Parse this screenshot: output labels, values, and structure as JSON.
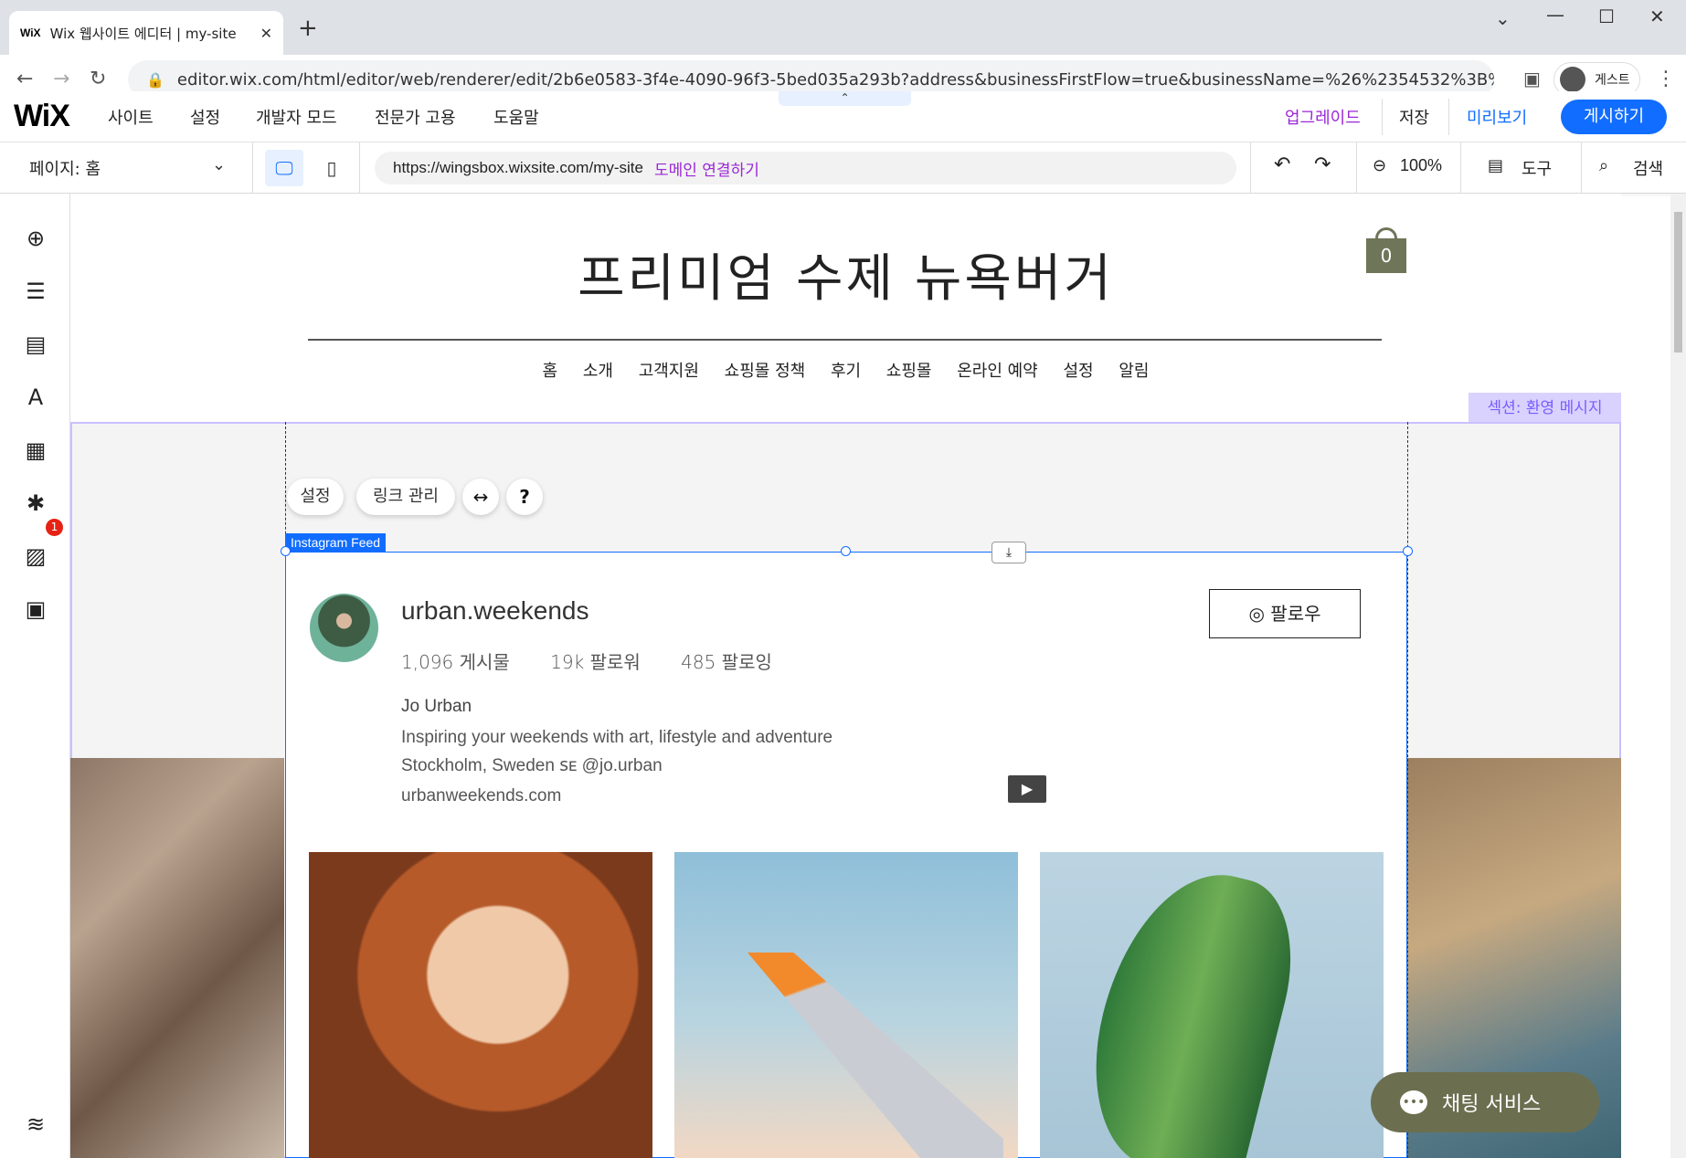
{
  "browser": {
    "tab_favicon": "WiX",
    "tab_title": "Wix 웹사이트 에디터 | my-site",
    "url": "editor.wix.com/html/editor/web/renderer/edit/2b6e0583-3f4e-4090-96f3-5bed035a293b?address&businessFirstFlow=true&businessName=%26%2354532%3B%26%2347532%3B%26...",
    "profile_label": "게스트"
  },
  "wix_top": {
    "logo": "WiX",
    "menu": [
      "사이트",
      "설정",
      "개발자 모드",
      "전문가 고용",
      "도움말"
    ],
    "upgrade": "업그레이드",
    "save": "저장",
    "preview": "미리보기",
    "publish": "게시하기"
  },
  "wix_second": {
    "page_selector": "페이지: 홈",
    "site_url": "https://wingsbox.wixsite.com/my-site",
    "connect_domain": "도메인 연결하기",
    "zoom": "100%",
    "tools": "도구",
    "search": "검색"
  },
  "sidebar": {
    "icons": [
      "add-icon",
      "sections-icon",
      "pages-icon",
      "design-icon",
      "apps-icon",
      "business-icon",
      "media-icon",
      "portfolio-icon",
      "layers-icon"
    ],
    "badge": "1"
  },
  "site": {
    "title": "프리미엄 수제 뉴욕버거",
    "cart_count": "0",
    "nav": [
      "홈",
      "소개",
      "고객지원",
      "쇼핑몰 정책",
      "후기",
      "쇼핑몰",
      "온라인 예약",
      "설정",
      "알림"
    ],
    "section_tag": "섹션: 환영 메시지"
  },
  "widget": {
    "toolbar_settings": "설정",
    "toolbar_links": "링크 관리",
    "stretch_icon": "↔",
    "help_icon": "?",
    "tag": "Instagram Feed"
  },
  "instagram": {
    "username": "urban.weekends",
    "posts": "1,096 게시물",
    "followers": "19k 팔로워",
    "following": "485 팔로잉",
    "name": "Jo Urban",
    "bio1": "Inspiring your weekends with art, lifestyle and adventure",
    "bio2": "Stockholm, Sweden ꜱᴇ @jo.urban",
    "website": "urbanweekends.com",
    "follow": "팔로우"
  },
  "chat": {
    "label": "채팅 서비스"
  },
  "colors": {
    "wix_blue": "#116dff",
    "upgrade_purple": "#9a27d5",
    "olive": "#6f7558",
    "section_purple": "#7a5cff"
  }
}
